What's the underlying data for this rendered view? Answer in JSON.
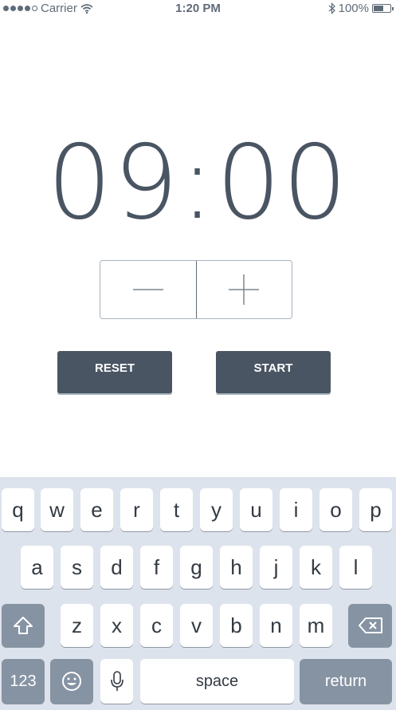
{
  "status_bar": {
    "carrier": "Carrier",
    "time": "1:20 PM",
    "battery": "100%",
    "battery_level": 0.6
  },
  "timer": {
    "display": "09:00"
  },
  "stepper": {
    "decrement_icon": "minus-icon",
    "increment_icon": "plus-icon"
  },
  "buttons": {
    "reset": "RESET",
    "start": "START"
  },
  "keyboard": {
    "row1": [
      "q",
      "w",
      "e",
      "r",
      "t",
      "y",
      "u",
      "i",
      "o",
      "p"
    ],
    "row2": [
      "a",
      "s",
      "d",
      "f",
      "g",
      "h",
      "j",
      "k",
      "l"
    ],
    "row3": [
      "z",
      "x",
      "c",
      "v",
      "b",
      "n",
      "m"
    ],
    "numbers": "123",
    "space": "space",
    "return": "return"
  },
  "colors": {
    "accent": "#4a5563",
    "keyboard_bg": "#dde3ec",
    "special_key": "#8693a3"
  }
}
